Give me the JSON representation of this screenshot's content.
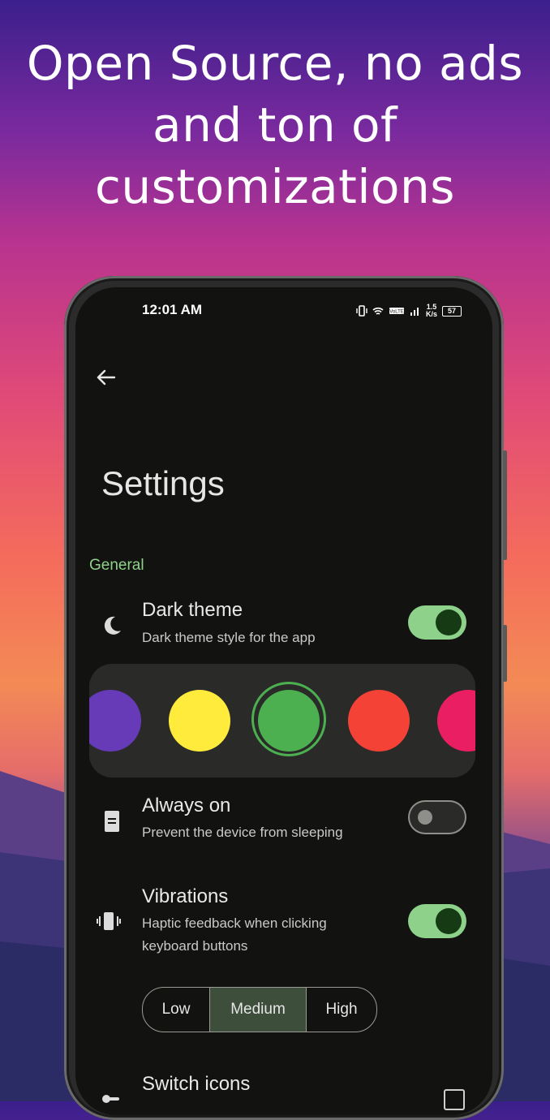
{
  "headline": "Open Source, no ads and ton of customizations",
  "status_bar": {
    "time": "12:01 AM",
    "net_speed_value": "1.5",
    "net_speed_unit": "K/s",
    "battery": "57"
  },
  "settings": {
    "title": "Settings",
    "section_general": "General",
    "dark_theme": {
      "title": "Dark theme",
      "subtitle": "Dark theme style for the app",
      "enabled": true
    },
    "palette": {
      "colors": [
        "#673ab7",
        "#ffeb3b",
        "#4caf50",
        "#f44336",
        "#e91e63"
      ],
      "selected": "#4caf50"
    },
    "always_on": {
      "title": "Always on",
      "subtitle": "Prevent the device from sleeping",
      "enabled": false
    },
    "vibrations": {
      "title": "Vibrations",
      "subtitle_line1": "Haptic feedback when clicking",
      "subtitle_line2": "keyboard buttons",
      "enabled": true,
      "levels": [
        "Low",
        "Medium",
        "High"
      ],
      "selected_level": "Medium"
    },
    "switch_icons": {
      "title": "Switch icons",
      "checked": false
    }
  },
  "colors": {
    "screen_bg": "#121310",
    "accent_green": "#8fd08a",
    "toggle_on": "#8dd18a"
  }
}
